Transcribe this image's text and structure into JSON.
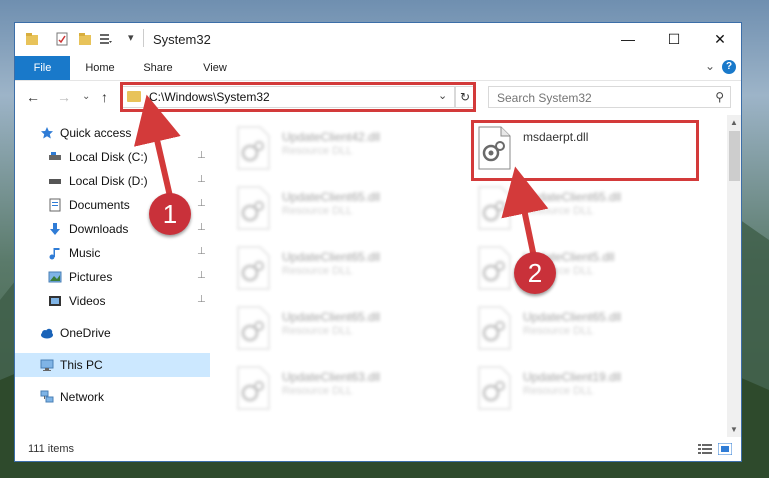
{
  "window": {
    "title": "System32",
    "minimize_glyph": "—",
    "maximize_glyph": "☐",
    "close_glyph": "✕"
  },
  "ribbon": {
    "tabs": [
      {
        "label": "File"
      },
      {
        "label": "Home"
      },
      {
        "label": "Share"
      },
      {
        "label": "View"
      }
    ],
    "expand_glyph": "⌄",
    "help_glyph": "?"
  },
  "address": {
    "path": "C:\\Windows\\System32",
    "search_placeholder": "Search System32",
    "back_glyph": "←",
    "forward_glyph": "→",
    "recent_glyph": "⌄",
    "up_glyph": "↑",
    "dropdown_glyph": "⌄",
    "refresh_glyph": "↻",
    "search_glyph": "⚲"
  },
  "sidebar": {
    "items": [
      {
        "label": "Quick access",
        "icon": "star-icon"
      },
      {
        "label": "Local Disk (C:)",
        "icon": "drive-icon"
      },
      {
        "label": "Local Disk (D:)",
        "icon": "drive-icon"
      },
      {
        "label": "Documents",
        "icon": "document-icon"
      },
      {
        "label": "Downloads",
        "icon": "download-icon"
      },
      {
        "label": "Music",
        "icon": "music-icon"
      },
      {
        "label": "Pictures",
        "icon": "picture-icon"
      },
      {
        "label": "Videos",
        "icon": "video-icon"
      },
      {
        "label": "OneDrive",
        "icon": "cloud-icon"
      },
      {
        "label": "This PC",
        "icon": "computer-icon"
      },
      {
        "label": "Network",
        "icon": "network-icon"
      }
    ],
    "pin_glyph": "📌"
  },
  "files": {
    "left_column": [
      {
        "name": "UpdateClient42.dll",
        "type": "Resource DLL"
      },
      {
        "name": "UpdateClient65.dll",
        "type": "Resource DLL"
      },
      {
        "name": "UpdateClient65.dll",
        "type": "Resource DLL"
      },
      {
        "name": "UpdateClient65.dll",
        "type": "Resource DLL"
      },
      {
        "name": "UpdateClient63.dll",
        "type": "Resource DLL"
      }
    ],
    "right_column": [
      {
        "name": "msdaerpt.dll",
        "type": ""
      },
      {
        "name": "UpdateClient65.dll",
        "type": "Resource DLL"
      },
      {
        "name": "UpdateClient5.dll",
        "type": "Resource DLL"
      },
      {
        "name": "UpdateClient65.dll",
        "type": "Resource DLL"
      },
      {
        "name": "UpdateClient19.dll",
        "type": "Resource DLL"
      }
    ]
  },
  "status": {
    "item_count": "111 items"
  },
  "annotations": {
    "badge1": "1",
    "badge2": "2",
    "highlight_color": "#d33a3a"
  },
  "colors": {
    "file_tab": "#1979ca",
    "selection": "#cce8ff",
    "badge": "#c9313a"
  }
}
